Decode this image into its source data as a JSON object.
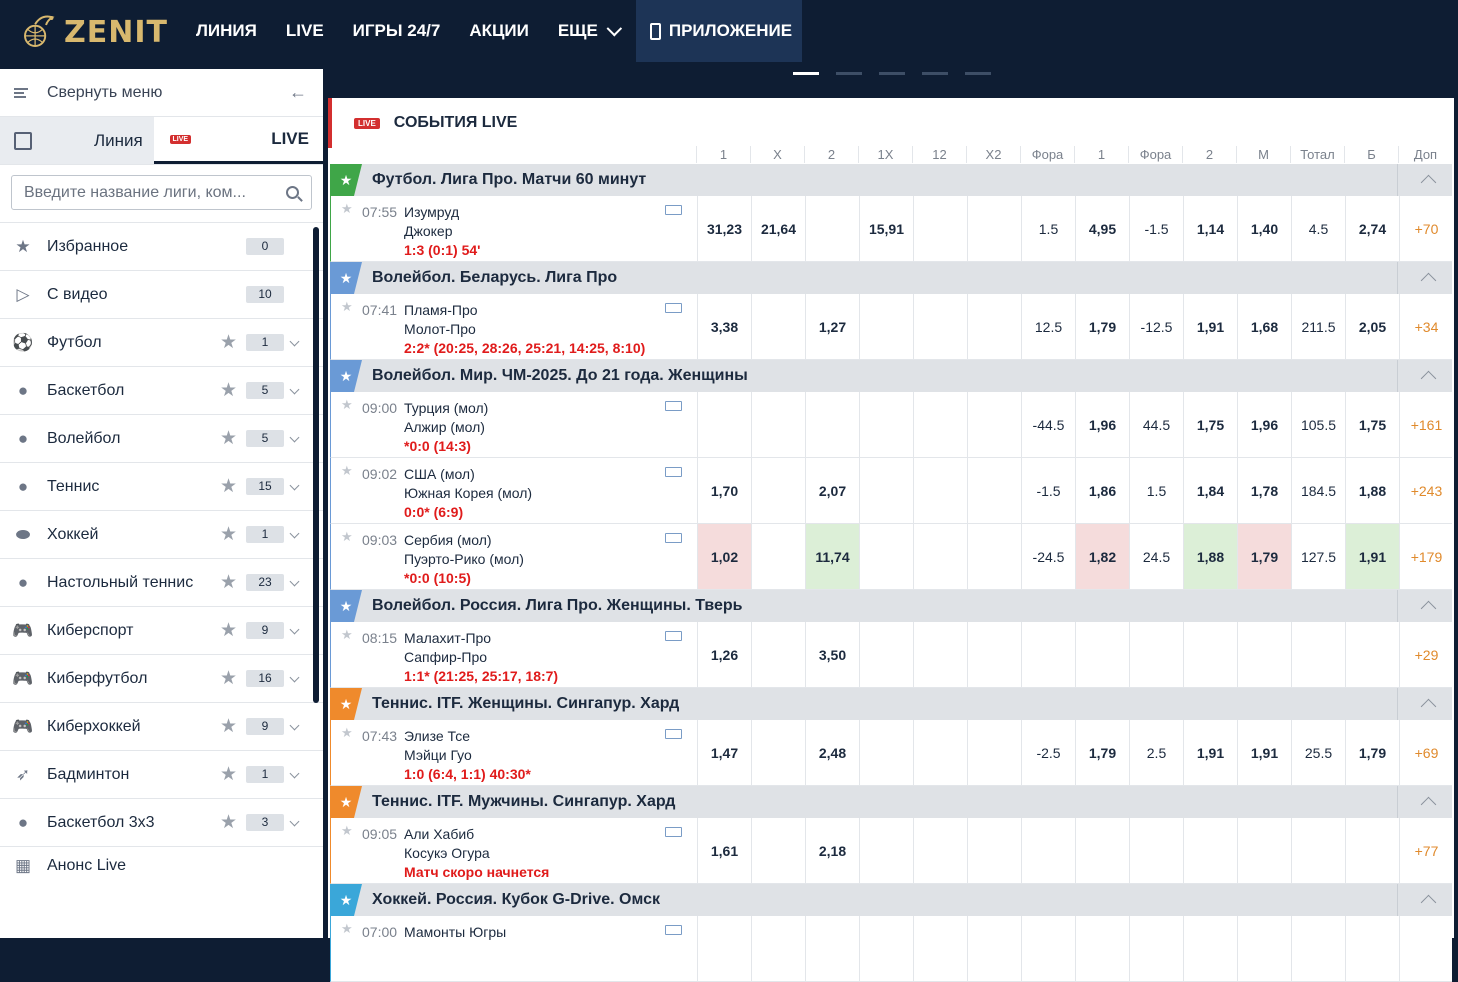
{
  "header": {
    "brand": "ZENIT",
    "nav": [
      "ЛИНИЯ",
      "LIVE",
      "ИГРЫ 24/7",
      "АКЦИИ",
      "ЕЩЕ"
    ],
    "app_label": "ПРИЛОЖЕНИЕ",
    "accent": "#d8b86e",
    "bg": "#0e1d33"
  },
  "sidebar": {
    "collapse_label": "Свернуть меню",
    "tab_line": "Линия",
    "tab_live": "LIVE",
    "live_badge": "LIVE",
    "search_placeholder": "Введите название лиги, ком...",
    "items": [
      {
        "label": "Избранное",
        "count": "0",
        "icon": "star-icon",
        "glyph": "★"
      },
      {
        "label": "С видео",
        "count": "10",
        "icon": "video-icon",
        "glyph": "▷"
      },
      {
        "label": "Футбол",
        "count": "1",
        "icon": "football-icon",
        "glyph": "⚽"
      },
      {
        "label": "Баскетбол",
        "count": "5",
        "icon": "basketball-icon",
        "glyph": "●"
      },
      {
        "label": "Волейбол",
        "count": "5",
        "icon": "volleyball-icon",
        "glyph": "●"
      },
      {
        "label": "Теннис",
        "count": "15",
        "icon": "tennis-icon",
        "glyph": "●"
      },
      {
        "label": "Хоккей",
        "count": "1",
        "icon": "hockey-puck-icon",
        "glyph": "⬬"
      },
      {
        "label": "Настольный теннис",
        "count": "23",
        "icon": "table-tennis-icon",
        "glyph": "●"
      },
      {
        "label": "Киберспорт",
        "count": "9",
        "icon": "gamepad-icon",
        "glyph": "🎮"
      },
      {
        "label": "Киберфутбол",
        "count": "16",
        "icon": "gamepad-icon",
        "glyph": "🎮"
      },
      {
        "label": "Киберхоккей",
        "count": "9",
        "icon": "gamepad-icon",
        "glyph": "🎮"
      },
      {
        "label": "Бадминтон",
        "count": "1",
        "icon": "shuttlecock-icon",
        "glyph": "➶"
      },
      {
        "label": "Баскетбол 3х3",
        "count": "3",
        "icon": "basketball-3x3-icon",
        "glyph": "●"
      }
    ],
    "anons": "Анонс Live"
  },
  "main": {
    "live_badge": "LIVE",
    "title": "СОБЫТИЯ LIVE",
    "columns": [
      "1",
      "X",
      "2",
      "1X",
      "12",
      "X2",
      "Фора",
      "1",
      "Фора",
      "2",
      "М",
      "Тотал",
      "Б",
      "Доп"
    ],
    "leagues": [
      {
        "name": "Футбол. Лига Про. Матчи 60 минут",
        "color": "#3fa648",
        "events": [
          {
            "time": "07:55",
            "t1": "Изумруд",
            "t2": "Джокер",
            "score": "1:3 (0:1) 54'",
            "odds": [
              "31,23",
              "21,64",
              "",
              "15,91",
              "",
              "",
              "1.5",
              "4,95",
              "-1.5",
              "1,14",
              "1,40",
              "4.5",
              "2,74",
              "+70"
            ],
            "hl": {}
          }
        ]
      },
      {
        "name": "Волейбол. Беларусь. Лига Про",
        "color": "#6a9ad6",
        "events": [
          {
            "time": "07:41",
            "t1": "Пламя-Про",
            "t2": "Молот-Про",
            "score": "2:2* (20:25, 28:26, 25:21, 14:25, 8:10)",
            "odds": [
              "3,38",
              "",
              "1,27",
              "",
              "",
              "",
              "12.5",
              "1,79",
              "-12.5",
              "1,91",
              "1,68",
              "211.5",
              "2,05",
              "+34"
            ],
            "hl": {}
          }
        ]
      },
      {
        "name": "Волейбол. Мир. ЧМ-2025. До 21 года. Женщины",
        "color": "#6a9ad6",
        "events": [
          {
            "time": "09:00",
            "t1": "Турция (мол)",
            "t2": "Алжир (мол)",
            "score": "*0:0 (14:3)",
            "odds": [
              "",
              "",
              "",
              "",
              "",
              "",
              "-44.5",
              "1,96",
              "44.5",
              "1,75",
              "1,96",
              "105.5",
              "1,75",
              "+161"
            ],
            "hl": {}
          },
          {
            "time": "09:02",
            "t1": "США (мол)",
            "t2": "Южная Корея (мол)",
            "score": "0:0* (6:9)",
            "odds": [
              "1,70",
              "",
              "2,07",
              "",
              "",
              "",
              "-1.5",
              "1,86",
              "1.5",
              "1,84",
              "1,78",
              "184.5",
              "1,88",
              "+243"
            ],
            "hl": {}
          },
          {
            "time": "09:03",
            "t1": "Сербия (мол)",
            "t2": "Пуэрто-Рико (мол)",
            "score": "*0:0 (10:5)",
            "odds": [
              "1,02",
              "",
              "11,74",
              "",
              "",
              "",
              "-24.5",
              "1,82",
              "24.5",
              "1,88",
              "1,79",
              "127.5",
              "1,91",
              "+179"
            ],
            "hl": {
              "0": "red",
              "2": "green",
              "7": "red",
              "9": "green",
              "10": "red",
              "12": "green"
            }
          }
        ]
      },
      {
        "name": "Волейбол. Россия. Лига Про. Женщины. Тверь",
        "color": "#6a9ad6",
        "events": [
          {
            "time": "08:15",
            "t1": "Малахит-Про",
            "t2": "Сапфир-Про",
            "score": "1:1* (21:25, 25:17, 18:7)",
            "odds": [
              "1,26",
              "",
              "3,50",
              "",
              "",
              "",
              "",
              "",
              "",
              "",
              "",
              "",
              "",
              "+29"
            ],
            "hl": {}
          }
        ]
      },
      {
        "name": "Теннис. ITF. Женщины. Сингапур. Хард",
        "color": "#ef8a2c",
        "events": [
          {
            "time": "07:43",
            "t1": "Элизе Тсе",
            "t2": "Мэйци Гуо",
            "score": "1:0 (6:4, 1:1) 40:30*",
            "odds": [
              "1,47",
              "",
              "2,48",
              "",
              "",
              "",
              "-2.5",
              "1,79",
              "2.5",
              "1,91",
              "1,91",
              "25.5",
              "1,79",
              "+69"
            ],
            "hl": {}
          }
        ]
      },
      {
        "name": "Теннис. ITF. Мужчины. Сингапур. Хард",
        "color": "#ef8a2c",
        "events": [
          {
            "time": "09:05",
            "t1": "Али Хабиб",
            "t2": "Косукэ Огура",
            "score": "Матч скоро начнется",
            "odds": [
              "1,61",
              "",
              "2,18",
              "",
              "",
              "",
              "",
              "",
              "",
              "",
              "",
              "",
              "",
              "+77"
            ],
            "hl": {}
          }
        ]
      },
      {
        "name": "Хоккей. Россия. Кубок G-Drive. Омск",
        "color": "#3aa7d9",
        "events": [
          {
            "time": "07:00",
            "t1": "Мамонты Югры",
            "t2": "",
            "score": "",
            "odds": [
              "",
              "",
              "",
              "",
              "",
              "",
              "",
              "",
              "",
              "",
              "",
              "",
              "",
              ""
            ],
            "hl": {}
          }
        ]
      }
    ]
  }
}
